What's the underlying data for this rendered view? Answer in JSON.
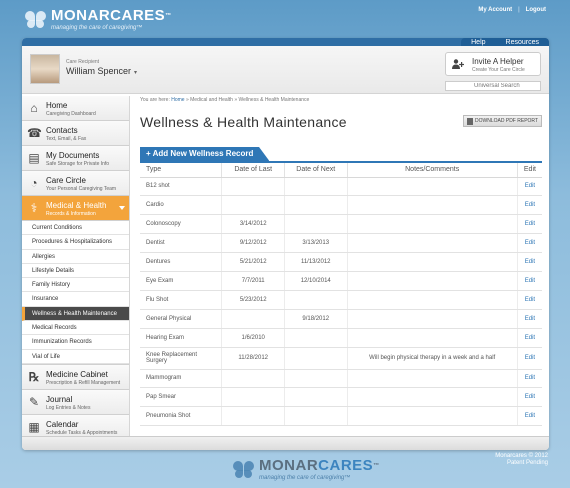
{
  "brand": {
    "name_part1": "MONAR",
    "name_part2": "CARES",
    "trademark": "™",
    "tagline": "managing the care of caregiving™"
  },
  "toplinks": {
    "my_account": "My Account",
    "separator": "|",
    "logout": "Logout"
  },
  "help_tabs": {
    "help": "Help",
    "resources": "Resources"
  },
  "recipient": {
    "label": "Care Recipient",
    "name": "William Spencer"
  },
  "invite": {
    "title": "Invite A Helper",
    "subtitle": "Create Your Care Circle"
  },
  "search": {
    "placeholder": "Universal Search"
  },
  "sidebar": {
    "items": [
      {
        "title": "Home",
        "sub": "Caregiving Dashboard",
        "icon": "home-icon"
      },
      {
        "title": "Contacts",
        "sub": "Text, Email, & Fax",
        "icon": "phone-icon"
      },
      {
        "title": "My Documents",
        "sub": "Safe Storage for Private Info",
        "icon": "documents-icon"
      },
      {
        "title": "Care Circle",
        "sub": "Your Personal Caregiving Team",
        "icon": "care-circle-icon"
      },
      {
        "title": "Medical & Health",
        "sub": "Records & Information",
        "icon": "caduceus-icon"
      }
    ],
    "subitems": [
      "Current Conditions",
      "Procedures & Hospitalizations",
      "Allergies",
      "Lifestyle Details",
      "Family History",
      "Insurance",
      "Wellness & Health Maintenance",
      "Medical Records",
      "Immunization Records",
      "Vial of Life"
    ],
    "items_after": [
      {
        "title": "Medicine Cabinet",
        "sub": "Prescription & Refill Management",
        "icon": "rx-icon"
      },
      {
        "title": "Journal",
        "sub": "Log Entries & Notes",
        "icon": "journal-icon"
      },
      {
        "title": "Calendar",
        "sub": "Schedule Tasks & Appointments",
        "icon": "calendar-icon"
      }
    ]
  },
  "breadcrumb": {
    "prefix": "You are here:",
    "home": "Home",
    "sep": "»",
    "section": "Medical and Health",
    "current": "Wellness & Health Maintenance"
  },
  "page_title": "Wellness & Health Maintenance",
  "pdf_button": "DOWNLOAD PDF REPORT",
  "add_button": "+ Add New Wellness Record",
  "table": {
    "headers": [
      "Type",
      "Date of Last",
      "Date of Next",
      "Notes/Comments",
      "Edit"
    ],
    "rows": [
      {
        "type": "B12 shot",
        "last": "",
        "next": "",
        "notes": "",
        "edit": "Edit"
      },
      {
        "type": "Cardio",
        "last": "",
        "next": "",
        "notes": "",
        "edit": "Edit"
      },
      {
        "type": "Colonoscopy",
        "last": "3/14/2012",
        "next": "",
        "notes": "",
        "edit": "Edit"
      },
      {
        "type": "Dentist",
        "last": "9/12/2012",
        "next": "3/13/2013",
        "notes": "",
        "edit": "Edit"
      },
      {
        "type": "Dentures",
        "last": "5/21/2012",
        "next": "11/13/2012",
        "notes": "",
        "edit": "Edit"
      },
      {
        "type": "Eye Exam",
        "last": "7/7/2011",
        "next": "12/10/2014",
        "notes": "",
        "edit": "Edit"
      },
      {
        "type": "Flu Shot",
        "last": "5/23/2012",
        "next": "",
        "notes": "",
        "edit": "Edit"
      },
      {
        "type": "General Physical",
        "last": "",
        "next": "9/18/2012",
        "notes": "",
        "edit": "Edit"
      },
      {
        "type": "Hearing Exam",
        "last": "1/6/2010",
        "next": "",
        "notes": "",
        "edit": "Edit"
      },
      {
        "type": "Knee Replacement Surgery",
        "last": "11/28/2012",
        "next": "",
        "notes": "Will begin physical therapy in a week and a half",
        "edit": "Edit"
      },
      {
        "type": "Mammogram",
        "last": "",
        "next": "",
        "notes": "",
        "edit": "Edit"
      },
      {
        "type": "Pap Smear",
        "last": "",
        "next": "",
        "notes": "",
        "edit": "Edit"
      },
      {
        "type": "Pneumonia Shot",
        "last": "",
        "next": "",
        "notes": "",
        "edit": "Edit"
      }
    ]
  },
  "footer": {
    "copyright": "Monarcares © 2012",
    "patent": "Patent Pending"
  },
  "colors": {
    "accent": "#2f77b6",
    "active_nav": "#f3a43c",
    "background": "#5d9bc7"
  }
}
